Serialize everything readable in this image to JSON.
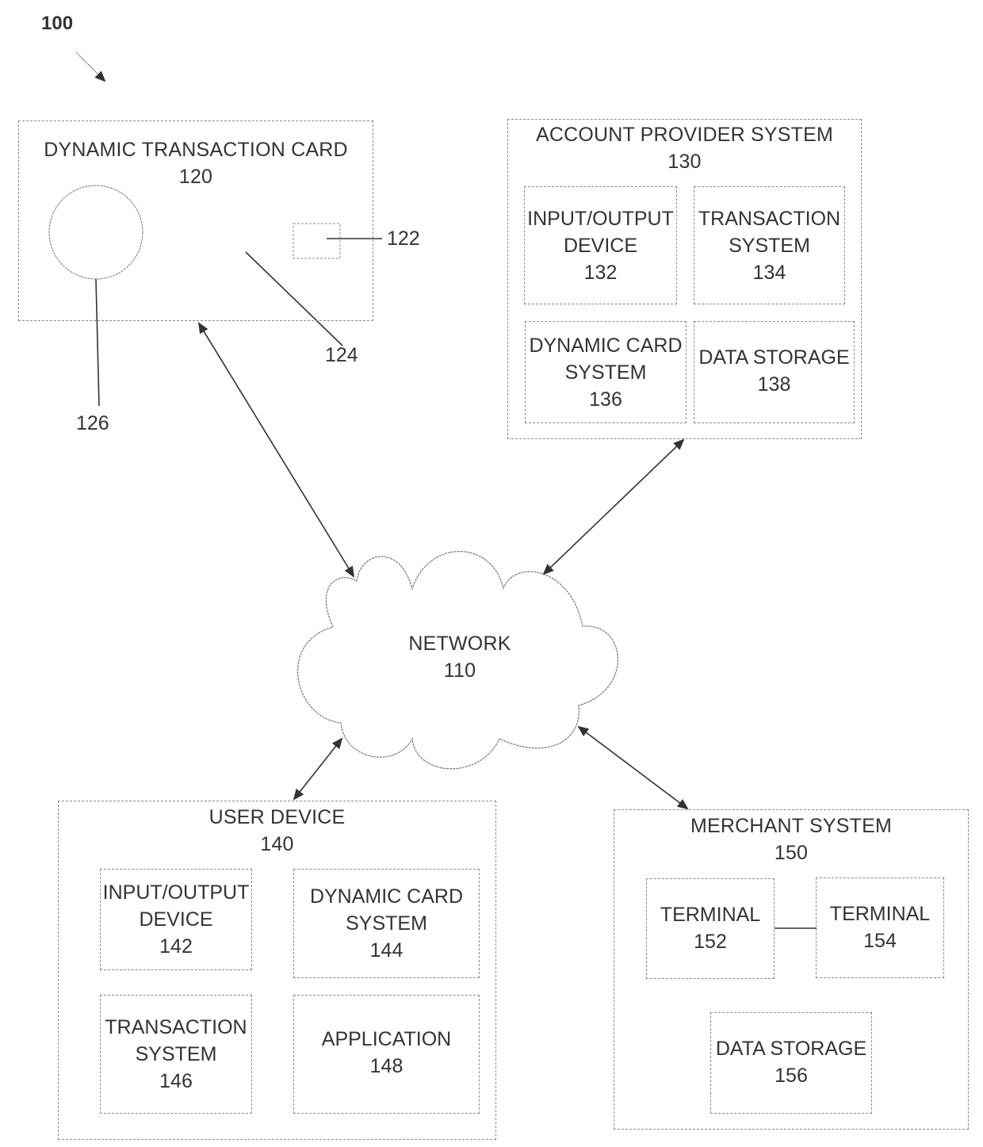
{
  "figure": {
    "id": "100"
  },
  "network": {
    "title": "NETWORK",
    "ref": "110"
  },
  "card": {
    "title": "DYNAMIC TRANSACTION CARD",
    "ref": "120",
    "callouts": {
      "chip": "122",
      "body": "124",
      "circle": "126"
    }
  },
  "account_provider": {
    "title": "ACCOUNT PROVIDER SYSTEM",
    "ref": "130",
    "components": [
      {
        "lines": [
          "INPUT/OUTPUT",
          "DEVICE"
        ],
        "ref": "132"
      },
      {
        "lines": [
          "TRANSACTION",
          "SYSTEM"
        ],
        "ref": "134"
      },
      {
        "lines": [
          "DYNAMIC CARD",
          "SYSTEM"
        ],
        "ref": "136"
      },
      {
        "lines": [
          "DATA STORAGE"
        ],
        "ref": "138"
      }
    ]
  },
  "user_device": {
    "title": "USER DEVICE",
    "ref": "140",
    "components": [
      {
        "lines": [
          "INPUT/OUTPUT",
          "DEVICE"
        ],
        "ref": "142"
      },
      {
        "lines": [
          "DYNAMIC CARD",
          "SYSTEM"
        ],
        "ref": "144"
      },
      {
        "lines": [
          "TRANSACTION",
          "SYSTEM"
        ],
        "ref": "146"
      },
      {
        "lines": [
          "APPLICATION"
        ],
        "ref": "148"
      }
    ]
  },
  "merchant": {
    "title": "MERCHANT SYSTEM",
    "ref": "150",
    "components": [
      {
        "lines": [
          "TERMINAL"
        ],
        "ref": "152"
      },
      {
        "lines": [
          "TERMINAL"
        ],
        "ref": "154"
      },
      {
        "lines": [
          "DATA STORAGE"
        ],
        "ref": "156"
      }
    ]
  }
}
